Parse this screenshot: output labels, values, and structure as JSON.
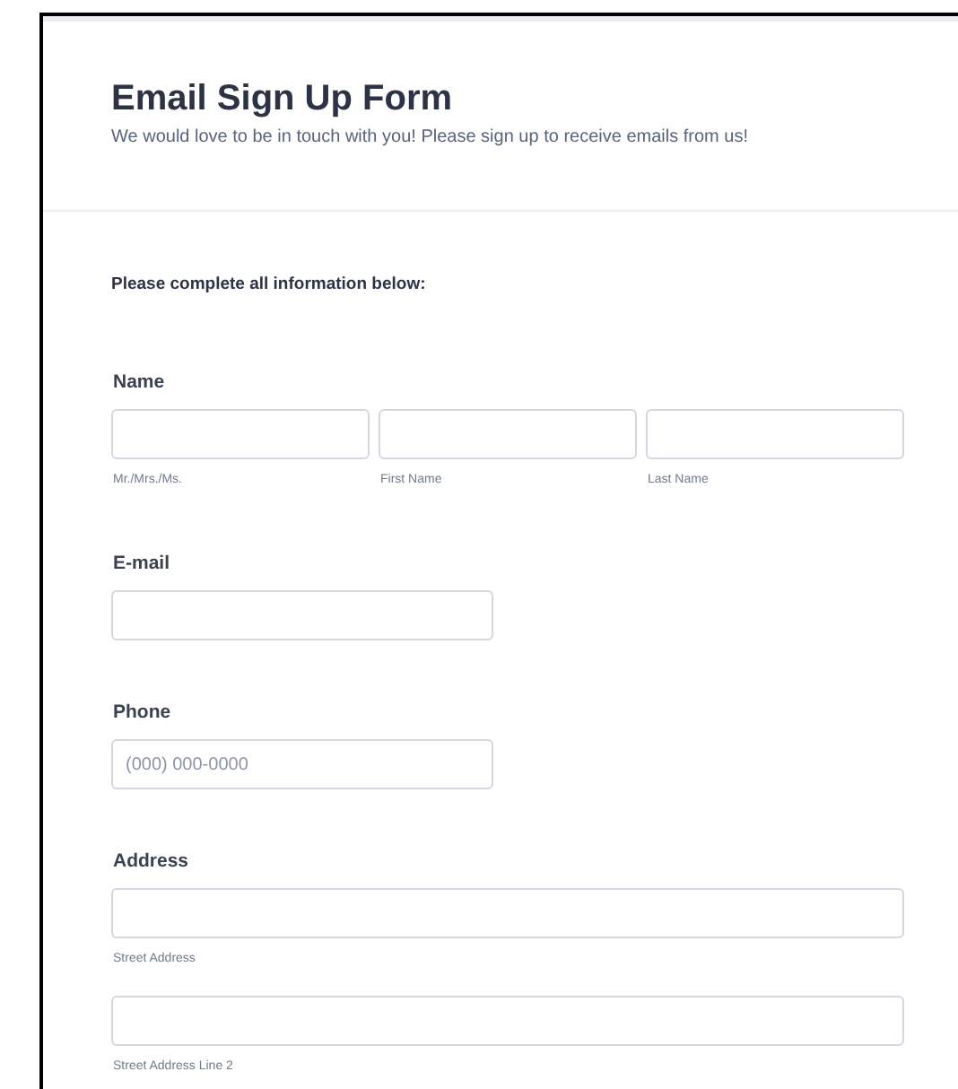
{
  "form": {
    "title": "Email Sign Up Form",
    "description": "We would love to be in touch with you! Please sign up to receive emails from us!",
    "intro": "Please complete all information below:"
  },
  "fields": [
    {
      "kind": "split",
      "label": "Name",
      "inputs": [
        {
          "sublabel": "Mr./Mrs./Ms."
        },
        {
          "sublabel": "First Name"
        },
        {
          "sublabel": "Last Name"
        }
      ]
    },
    {
      "kind": "short",
      "label": "E-mail"
    },
    {
      "kind": "short",
      "label": "Phone",
      "placeholder": "(000) 000-0000"
    },
    {
      "kind": "stack",
      "label": "Address",
      "inputs": [
        {
          "sublabel": "Street Address"
        },
        {
          "sublabel": "Street Address Line 2"
        }
      ]
    }
  ]
}
